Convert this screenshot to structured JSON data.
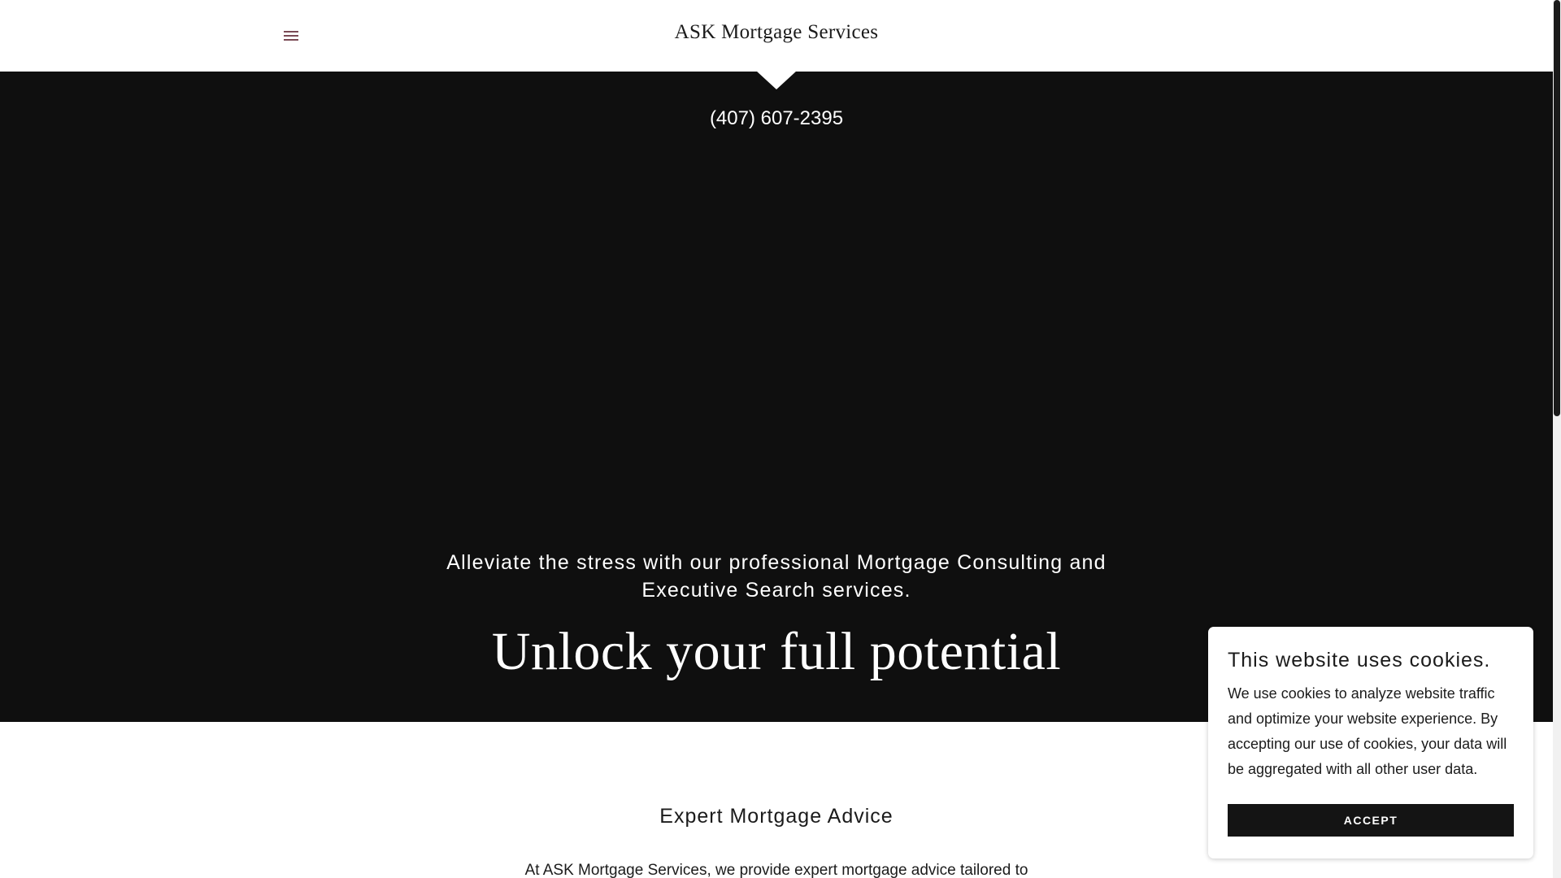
{
  "header": {
    "site_title": "ASK Mortgage Services",
    "menu_icon": "hamburger-menu-icon",
    "menu_icon_color": "#7a4a55"
  },
  "hero": {
    "phone": "(407) 607-2395",
    "tagline": "Alleviate the stress with our professional Mortgage Consulting and Executive Search services.",
    "heading": "Unlock your full potential",
    "background_color": "#0f0f0f"
  },
  "content": {
    "heading": "Expert Mortgage Advice",
    "body": "At ASK Mortgage Services, we provide expert mortgage advice tailored to"
  },
  "cookie_banner": {
    "title": "This website uses cookies.",
    "text": "We use cookies to analyze website traffic and optimize your website experience. By accepting our use of cookies, your data will be aggregated with all other user data.",
    "accept_label": "ACCEPT"
  }
}
